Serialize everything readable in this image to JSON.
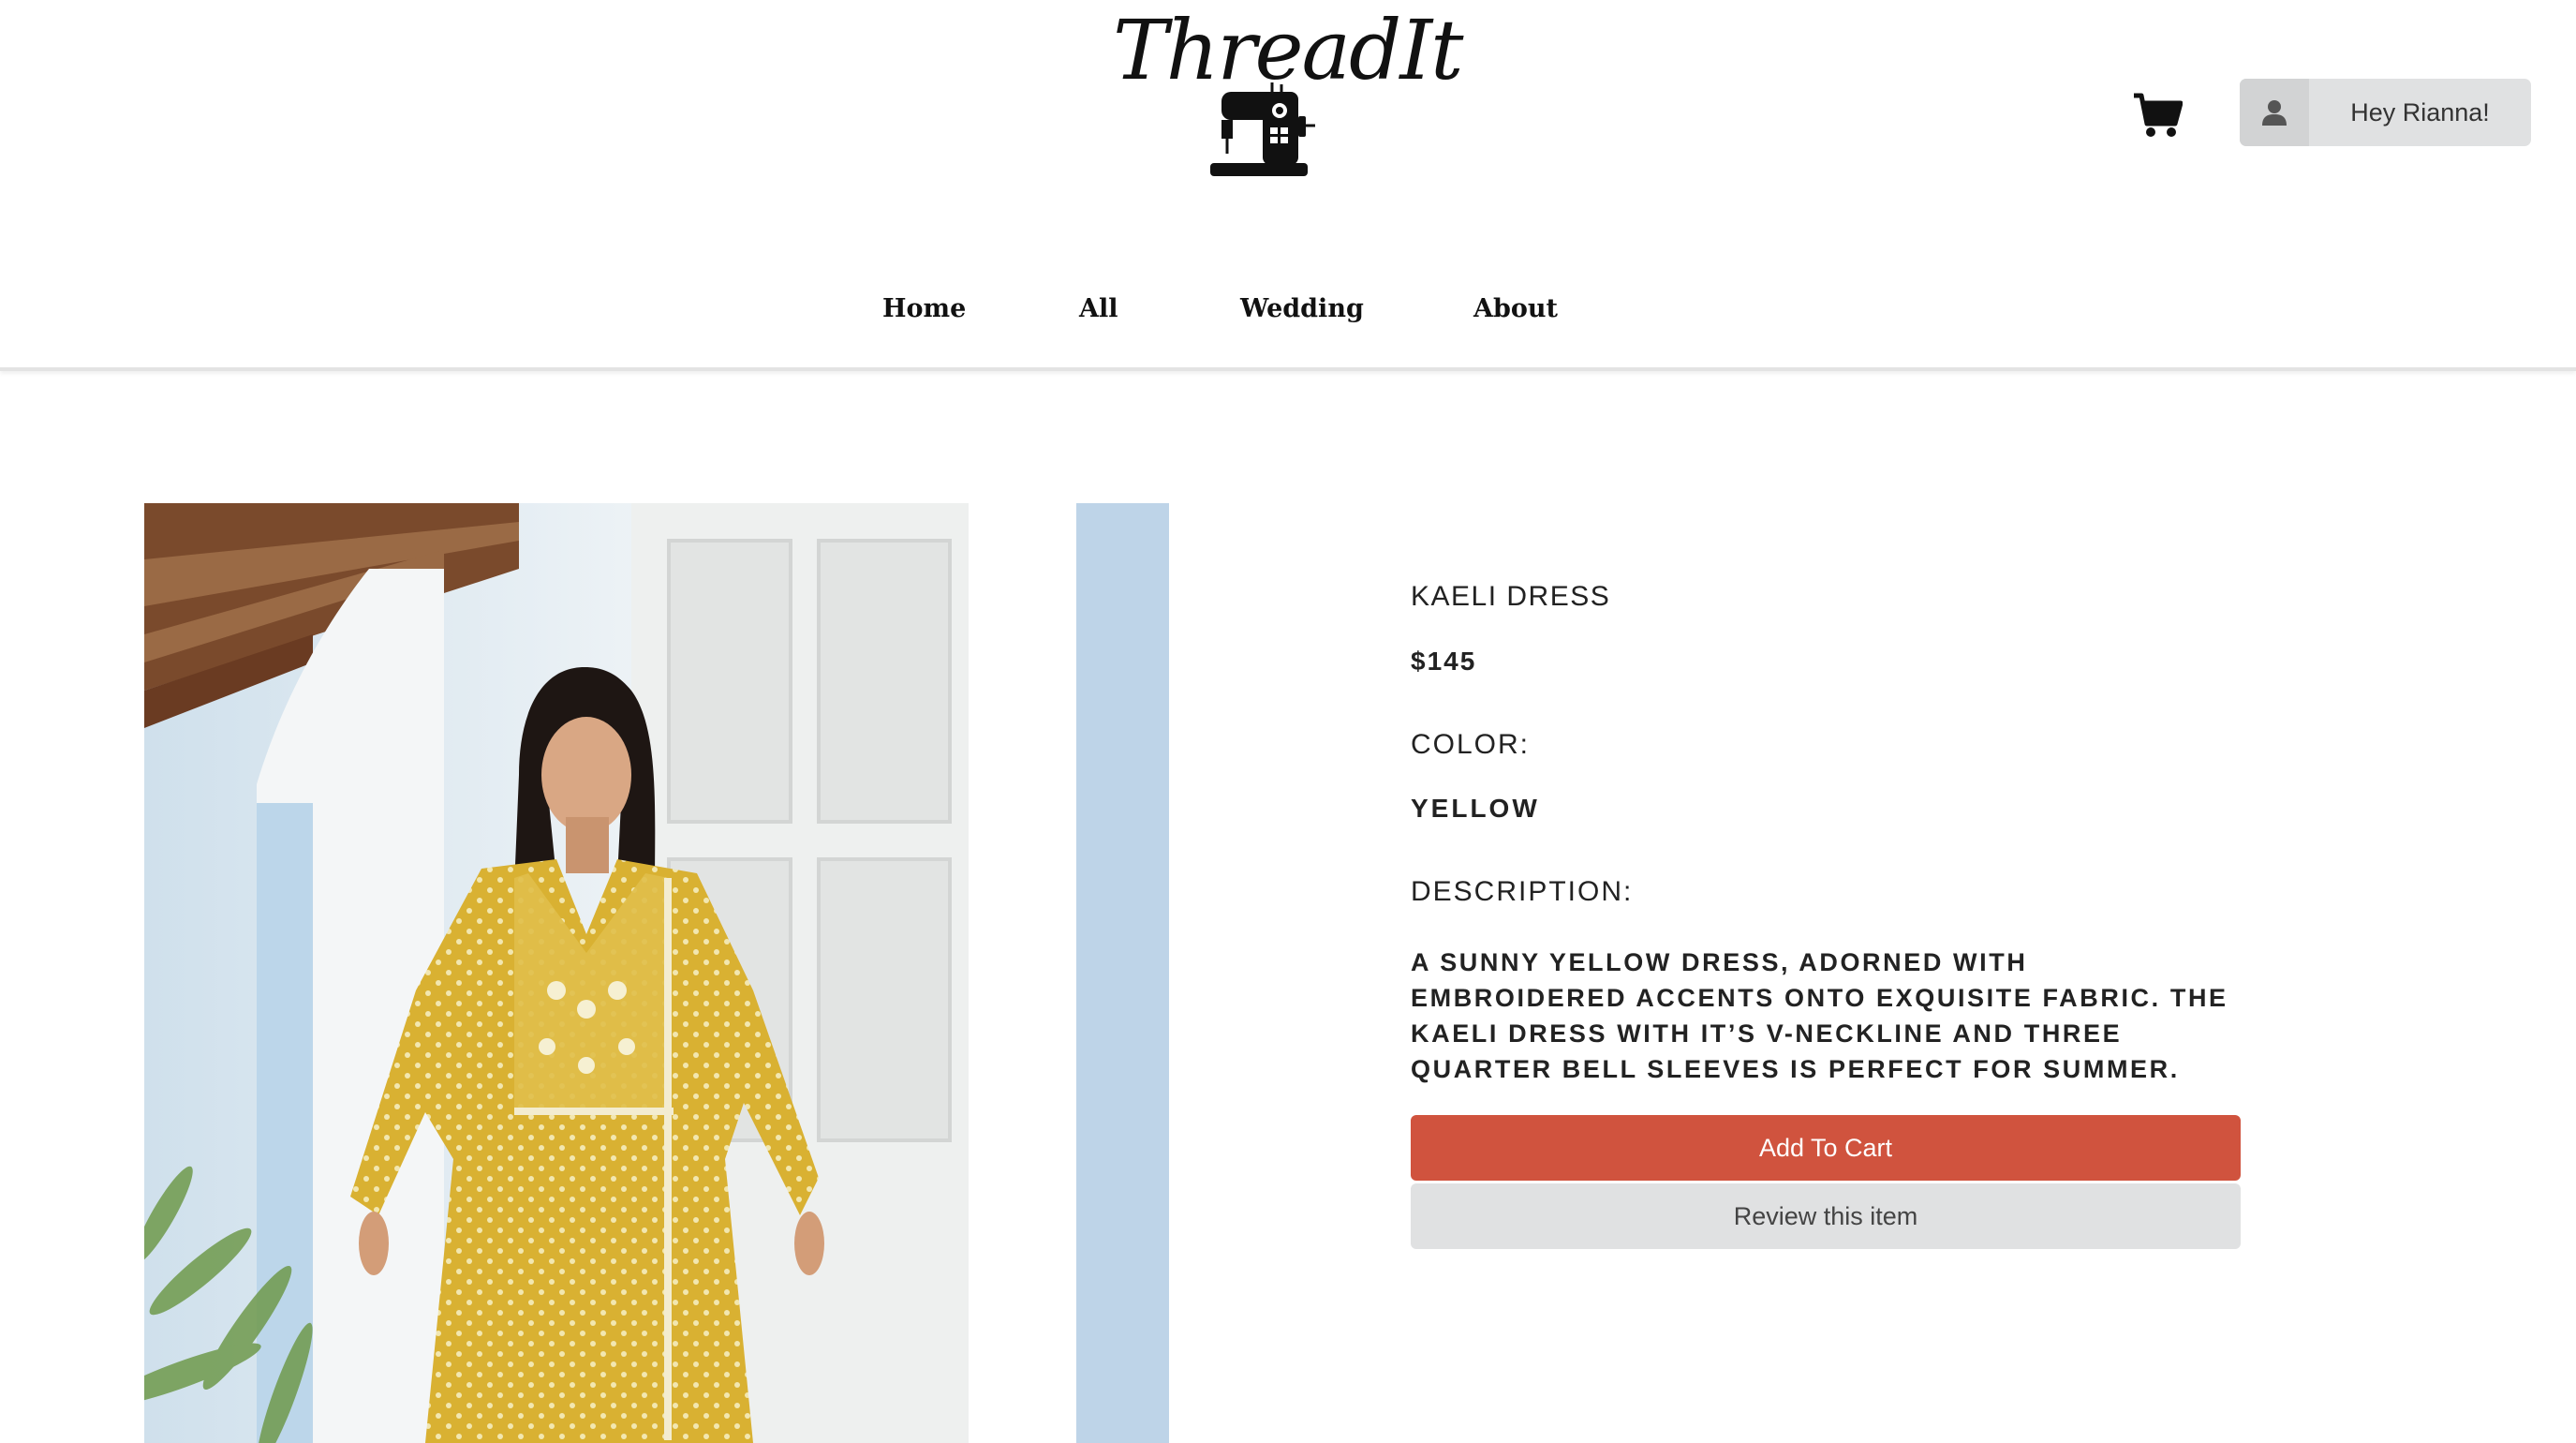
{
  "brand": {
    "name": "ThreadIt"
  },
  "header": {
    "cart_icon": "shopping-cart-icon",
    "user_icon": "user-icon",
    "user_greeting": "Hey Rianna!"
  },
  "nav": {
    "items": [
      {
        "label": "Home"
      },
      {
        "label": "All"
      },
      {
        "label": "Wedding"
      },
      {
        "label": "About"
      }
    ]
  },
  "product": {
    "title": "KAELI DRESS",
    "price": "$145",
    "color_label": "COLOR:",
    "color": "YELLOW",
    "description_label": "DESCRIPTION:",
    "description": "A SUNNY YELLOW DRESS, ADORNED WITH EMBROIDERED ACCENTS ONTO EXQUISITE FABRIC. THE KAELI DRESS WITH IT’S V-NECKLINE AND THREE QUARTER BELL SLEEVES IS PERFECT FOR SUMMER.",
    "add_to_cart_label": "Add To Cart",
    "review_label": "Review this item"
  },
  "colors": {
    "accent_red": "#d0533e",
    "button_gray": "#e0e1e2",
    "dress_yellow": "#d9b132"
  }
}
